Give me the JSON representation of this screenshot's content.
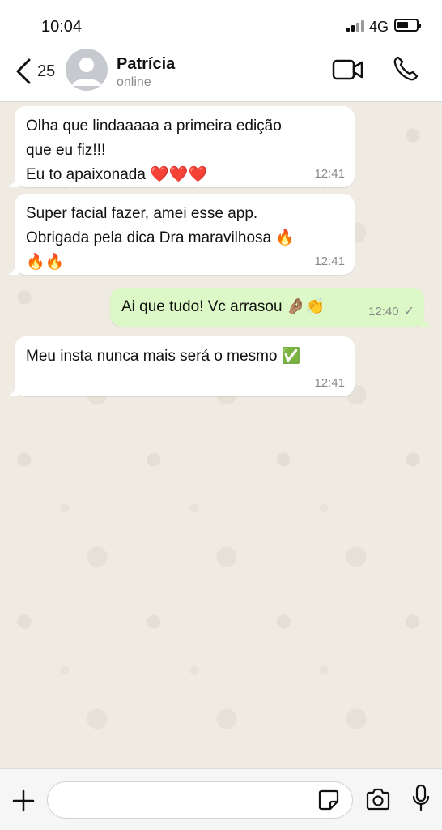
{
  "status_bar": {
    "time": "10:04",
    "network": "4G"
  },
  "header": {
    "back_count": "25",
    "contact_name": "Patrícia",
    "contact_status": "online"
  },
  "messages": [
    {
      "direction": "incoming",
      "text": "Olha que lindaaaaa a primeira edição\nque eu fiz!!!\nEu to apaixonada ❤️❤️❤️",
      "time": "12:41"
    },
    {
      "direction": "incoming",
      "text": "Super facial fazer, amei esse app.\nObrigada pela dica Dra maravilhosa 🔥\n🔥🔥",
      "time": "12:41"
    },
    {
      "direction": "outgoing",
      "text": "Ai que tudo! Vc arrasou 🤌🏽👏",
      "time": "12:40",
      "status": "✓"
    },
    {
      "direction": "incoming",
      "text": "Meu insta nunca mais será o mesmo ✅",
      "time": "12:41"
    }
  ],
  "input": {
    "value": "",
    "placeholder": ""
  },
  "colors": {
    "outgoing_bubble": "#dcf8c6",
    "incoming_bubble": "#ffffff",
    "chat_background": "#efeae2"
  },
  "icons": [
    "chevron-left-icon",
    "avatar-placeholder-icon",
    "video-camera-icon",
    "phone-icon",
    "plus-icon",
    "sticker-icon",
    "camera-icon",
    "microphone-icon",
    "single-check-icon"
  ]
}
